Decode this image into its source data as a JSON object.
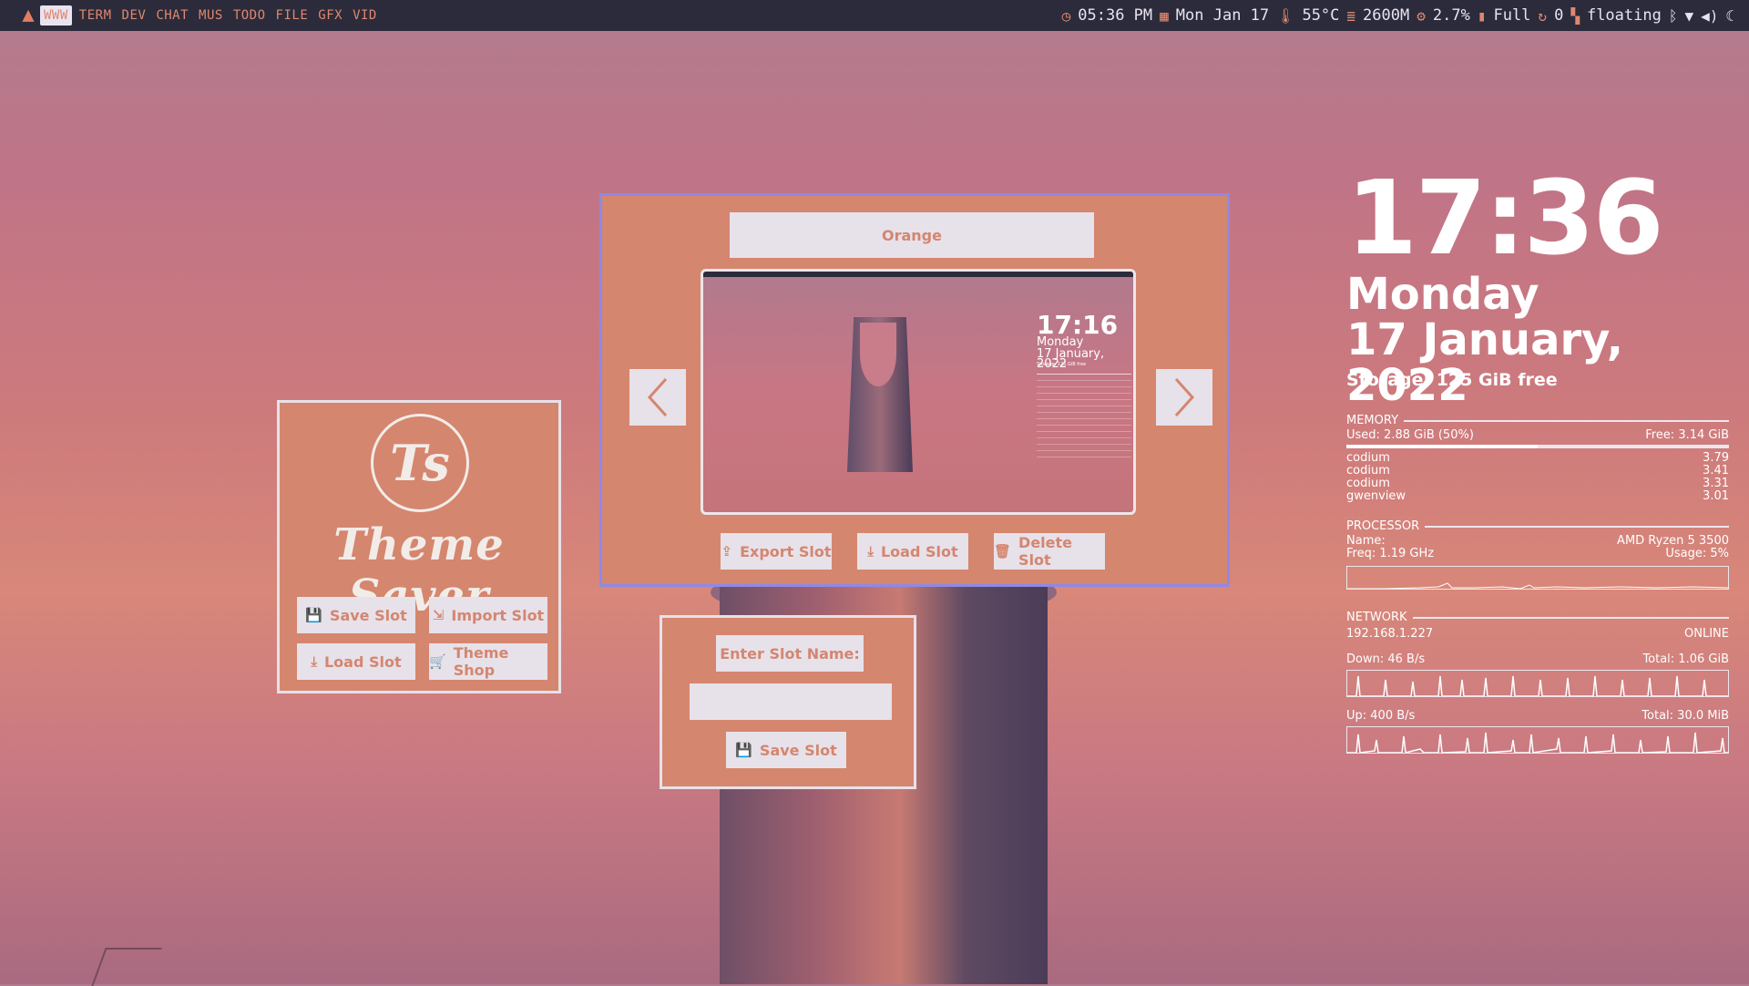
{
  "topbar": {
    "workspaces": [
      "WWW",
      "TERM",
      "DEV",
      "CHAT",
      "MUS",
      "TODO",
      "FILE",
      "GFX",
      "VID"
    ],
    "active_workspace": "WWW",
    "time": "05:36 PM",
    "date": "Mon Jan 17",
    "temp": "55°C",
    "memory": "2600M",
    "cpu": "2.7%",
    "battery": "Full",
    "updates": "0",
    "layout": "floating",
    "accent": "#e0876e"
  },
  "theme_saver": {
    "logo_letters": "Ts",
    "logo_text": "Theme Saver",
    "save_slot": "Save Slot",
    "import_slot": "Import Slot",
    "load_slot": "Load Slot",
    "theme_shop": "Theme Shop",
    "panel_color": "#d5866e"
  },
  "slot_viewer": {
    "slot_name": "Orange",
    "export_slot": "Export Slot",
    "load_slot": "Load Slot",
    "delete_slot": "Delete Slot",
    "preview": {
      "clock": "17:16",
      "day": "Monday",
      "date": "17 January, 2022",
      "storage": "Storage: 125 GiB free"
    }
  },
  "save_dialog": {
    "prompt": "Enter Slot Name:",
    "input_value": "",
    "save_slot": "Save Slot"
  },
  "conky": {
    "clock": "17:36",
    "day": "Monday",
    "date": "17 January, 2022",
    "storage": "Storage: 125 GiB free",
    "memory": {
      "title": "MEMORY",
      "used": "Used: 2.88 GiB (50%)",
      "free": "Free: 3.14 GiB",
      "used_fraction": 0.5,
      "processes": [
        {
          "name": "codium",
          "value": "3.79"
        },
        {
          "name": "codium",
          "value": "3.41"
        },
        {
          "name": "codium",
          "value": "3.31"
        },
        {
          "name": "gwenview",
          "value": "3.01"
        }
      ]
    },
    "processor": {
      "title": "PROCESSOR",
      "name": "Name:",
      "name_value": "AMD Ryzen 5 3500",
      "freq": "Freq: 1.19 GHz",
      "usage": "Usage: 5%"
    },
    "network": {
      "title": "NETWORK",
      "ip": "192.168.1.227",
      "status": "ONLINE",
      "down": "Down: 46 B/s",
      "down_total": "Total: 1.06 GiB",
      "up": "Up: 400 B/s",
      "up_total": "Total: 30.0 MiB"
    }
  }
}
